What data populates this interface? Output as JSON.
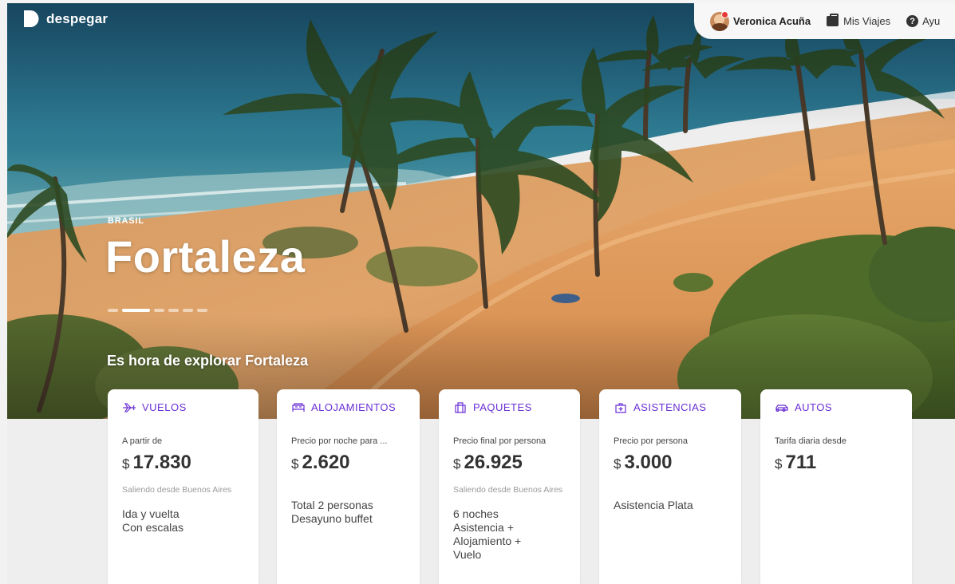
{
  "brand": {
    "name": "despegar"
  },
  "header": {
    "user_name": "Veronica Acuña",
    "trips_label": "Mis Viajes",
    "help_label": "Ayu"
  },
  "hero": {
    "country": "BRASIL",
    "city": "Fortaleza",
    "tagline": "Es hora de explorar Fortaleza",
    "carousel": {
      "total_slides": 6,
      "active_index": 1
    }
  },
  "cards": [
    {
      "category": "VUELOS",
      "icon": "plane-icon",
      "subtitle": "A partir de",
      "currency": "$",
      "price": "17.830",
      "note": "Saliendo desde Buenos Aires",
      "details": [
        "Ida y vuelta",
        "Con escalas"
      ]
    },
    {
      "category": "ALOJAMIENTOS",
      "icon": "bed-icon",
      "subtitle": "Precio por noche para ...",
      "currency": "$",
      "price": "2.620",
      "note": "",
      "details": [
        "Total 2 personas",
        "Desayuno buffet"
      ]
    },
    {
      "category": "PAQUETES",
      "icon": "suitcase-icon",
      "subtitle": "Precio final por persona",
      "currency": "$",
      "price": "26.925",
      "note": "Saliendo desde Buenos Aires",
      "details": [
        "6 noches",
        "Asistencia +",
        "Alojamiento +",
        "Vuelo"
      ]
    },
    {
      "category": "ASISTENCIAS",
      "icon": "medical-kit-icon",
      "subtitle": "Precio por persona",
      "currency": "$",
      "price": "3.000",
      "note": "",
      "details": [
        "Asistencia Plata"
      ]
    },
    {
      "category": "AUTOS",
      "icon": "car-icon",
      "subtitle": "Tarifa diaria desde",
      "currency": "$",
      "price": "711",
      "note": "",
      "details": []
    }
  ],
  "colors": {
    "accent": "#6a2fd6",
    "card_bg": "#ffffff",
    "page_bg": "#eeeeee"
  }
}
